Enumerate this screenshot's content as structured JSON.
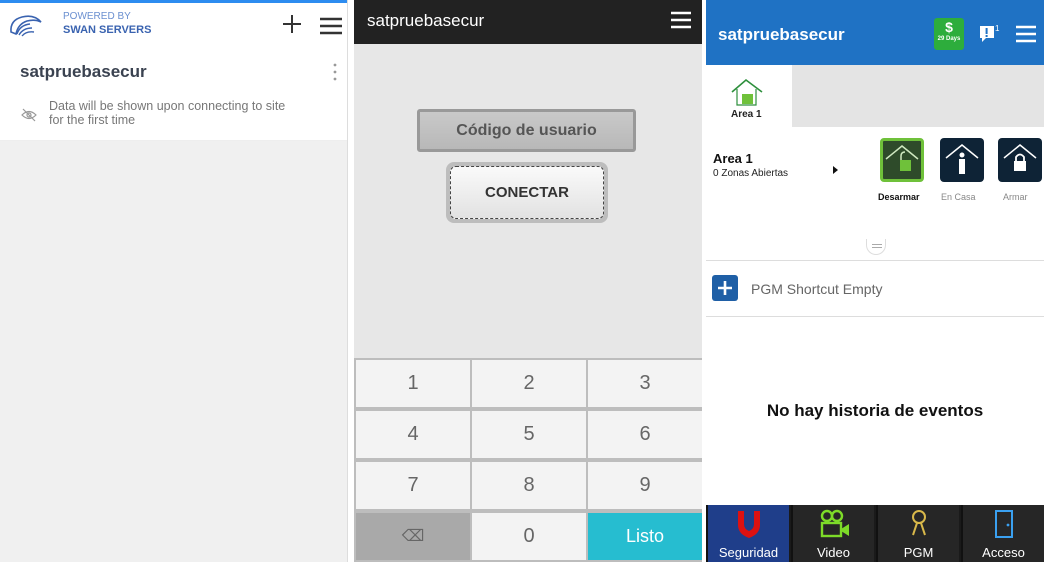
{
  "panel1": {
    "powered_by": "POWERED BY",
    "brand": "SWAN SERVERS",
    "site_name": "satpruebasecur",
    "note": "Data will be shown upon connecting to site for the first time"
  },
  "panel2": {
    "title": "satpruebasecur",
    "code_placeholder": "Código de usuario",
    "connect_label": "CONECTAR",
    "keys": [
      "1",
      "2",
      "3",
      "4",
      "5",
      "6",
      "7",
      "8",
      "9",
      "⌫",
      "0",
      "Listo"
    ]
  },
  "panel3": {
    "title": "satpruebasecur",
    "money_symbol": "$",
    "days": "29 Days",
    "alert_badge": "1",
    "tab_label": "Area 1",
    "area_name": "Area 1",
    "area_zones": "0 Zonas Abiertas",
    "arm_buttons": [
      {
        "label": "Desarmar"
      },
      {
        "label": "En Casa"
      },
      {
        "label": "Armar"
      }
    ],
    "pgm_text": "PGM Shortcut Empty",
    "no_events": "No hay historia de eventos",
    "nav": [
      {
        "label": "Seguridad"
      },
      {
        "label": "Video"
      },
      {
        "label": "PGM"
      },
      {
        "label": "Acceso"
      }
    ]
  },
  "colors": {
    "accent_blue": "#1f72c4",
    "green": "#6fc13a",
    "done_cyan": "#26bdd0"
  }
}
